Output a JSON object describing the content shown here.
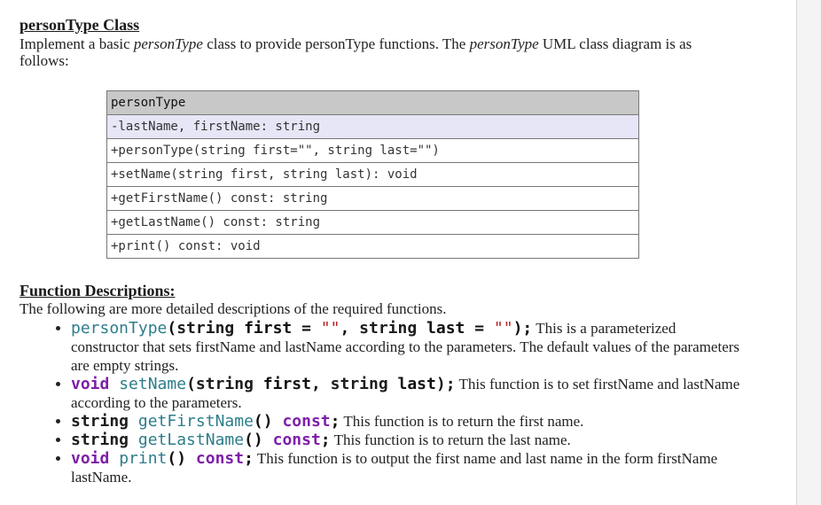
{
  "class_section": {
    "heading": "personType Class",
    "intro": {
      "p1": "Implement a basic ",
      "em1": "personType",
      "p2": " class to provide personType functions.   The ",
      "em2": "personType",
      "p3": " UML class diagram is as follows:"
    }
  },
  "uml": {
    "header": "personType",
    "attributes": "-lastName, firstName: string",
    "methods": [
      "+personType(string first=\"\", string last=\"\")",
      "+setName(string first, string last): void",
      "+getFirstName() const: string",
      "+getLastName() const: string",
      "+print() const: void"
    ]
  },
  "functions_section": {
    "heading": "Function Descriptions:",
    "intro": "The following are more detailed descriptions of the required functions.",
    "items": [
      {
        "code": {
          "fn": "personType",
          "open": "(",
          "t1": "string",
          "a1": " first = ",
          "s1": "\"\"",
          "c": ", ",
          "t2": "string",
          "a2": " last = ",
          "s2": "\"\"",
          "close": ");"
        },
        "text": " This is a parameterized constructor that sets firstName and lastName according to the parameters. The default values of the parameters are empty strings."
      },
      {
        "code": {
          "ret": "void",
          "fn": "setName",
          "open": "(",
          "t1": "string",
          "a1": " first, ",
          "t2": "string",
          "a2": " last",
          "close": ");"
        },
        "text": " This function is to set firstName and lastName according to the parameters."
      },
      {
        "code": {
          "ret": "string",
          "fn": "getFirstName",
          "paren": "() ",
          "cst": "const",
          "semi": ";"
        },
        "text": " This function is to return the first name."
      },
      {
        "code": {
          "ret": "string",
          "fn": "getLastName",
          "paren": "() ",
          "cst": "const",
          "semi": ";"
        },
        "text": " This function is to return the last name."
      },
      {
        "code": {
          "ret": "void",
          "fn": "print",
          "paren": "() ",
          "cst": "const",
          "semi": ";"
        },
        "text": " This function is to output the first name and last name in the form firstName lastName."
      }
    ]
  }
}
